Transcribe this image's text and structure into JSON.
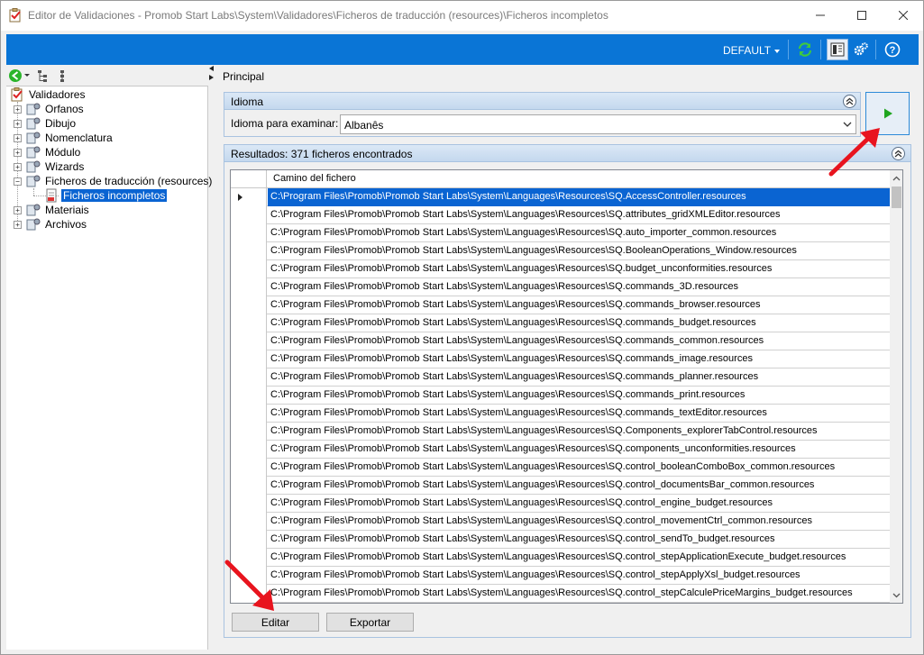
{
  "window": {
    "title": "Editor de Validaciones - Promob Start Labs\\System\\Validadores\\Ficheros de traducción (resources)\\Ficheros incompletos"
  },
  "toolbar": {
    "profile": "DEFAULT",
    "icons": [
      "refresh-icon",
      "layout-panel-icon",
      "settings-gears-icon",
      "help-icon"
    ]
  },
  "tree": {
    "root": "Validadores",
    "items": [
      {
        "label": "Orfanos",
        "expanded": false
      },
      {
        "label": "Dibujo",
        "expanded": false
      },
      {
        "label": "Nomenclatura",
        "expanded": false
      },
      {
        "label": "Módulo",
        "expanded": false
      },
      {
        "label": "Wizards",
        "expanded": false
      },
      {
        "label": "Ficheros de traducción (resources)",
        "expanded": true
      },
      {
        "label": "Materiais",
        "expanded": false
      },
      {
        "label": "Archivos",
        "expanded": false
      }
    ],
    "selected_child": "Ficheros incompletos"
  },
  "main": {
    "tab": "Principal",
    "idioma": {
      "title": "Idioma",
      "label": "Idioma para examinar:",
      "value": "Albanês"
    },
    "results": {
      "title": "Resultados: 371 ficheros encontrados",
      "column": "Camino del fichero",
      "rows": [
        "C:\\Program Files\\Promob\\Promob Start Labs\\System\\Languages\\Resources\\SQ.AccessController.resources",
        "C:\\Program Files\\Promob\\Promob Start Labs\\System\\Languages\\Resources\\SQ.attributes_gridXMLEditor.resources",
        "C:\\Program Files\\Promob\\Promob Start Labs\\System\\Languages\\Resources\\SQ.auto_importer_common.resources",
        "C:\\Program Files\\Promob\\Promob Start Labs\\System\\Languages\\Resources\\SQ.BooleanOperations_Window.resources",
        "C:\\Program Files\\Promob\\Promob Start Labs\\System\\Languages\\Resources\\SQ.budget_unconformities.resources",
        "C:\\Program Files\\Promob\\Promob Start Labs\\System\\Languages\\Resources\\SQ.commands_3D.resources",
        "C:\\Program Files\\Promob\\Promob Start Labs\\System\\Languages\\Resources\\SQ.commands_browser.resources",
        "C:\\Program Files\\Promob\\Promob Start Labs\\System\\Languages\\Resources\\SQ.commands_budget.resources",
        "C:\\Program Files\\Promob\\Promob Start Labs\\System\\Languages\\Resources\\SQ.commands_common.resources",
        "C:\\Program Files\\Promob\\Promob Start Labs\\System\\Languages\\Resources\\SQ.commands_image.resources",
        "C:\\Program Files\\Promob\\Promob Start Labs\\System\\Languages\\Resources\\SQ.commands_planner.resources",
        "C:\\Program Files\\Promob\\Promob Start Labs\\System\\Languages\\Resources\\SQ.commands_print.resources",
        "C:\\Program Files\\Promob\\Promob Start Labs\\System\\Languages\\Resources\\SQ.commands_textEditor.resources",
        "C:\\Program Files\\Promob\\Promob Start Labs\\System\\Languages\\Resources\\SQ.Components_explorerTabControl.resources",
        "C:\\Program Files\\Promob\\Promob Start Labs\\System\\Languages\\Resources\\SQ.components_unconformities.resources",
        "C:\\Program Files\\Promob\\Promob Start Labs\\System\\Languages\\Resources\\SQ.control_booleanComboBox_common.resources",
        "C:\\Program Files\\Promob\\Promob Start Labs\\System\\Languages\\Resources\\SQ.control_documentsBar_common.resources",
        "C:\\Program Files\\Promob\\Promob Start Labs\\System\\Languages\\Resources\\SQ.control_engine_budget.resources",
        "C:\\Program Files\\Promob\\Promob Start Labs\\System\\Languages\\Resources\\SQ.control_movementCtrl_common.resources",
        "C:\\Program Files\\Promob\\Promob Start Labs\\System\\Languages\\Resources\\SQ.control_sendTo_budget.resources",
        "C:\\Program Files\\Promob\\Promob Start Labs\\System\\Languages\\Resources\\SQ.control_stepApplicationExecute_budget.resources",
        "C:\\Program Files\\Promob\\Promob Start Labs\\System\\Languages\\Resources\\SQ.control_stepApplyXsl_budget.resources",
        "C:\\Program Files\\Promob\\Promob Start Labs\\System\\Languages\\Resources\\SQ.control_stepCalculePriceMargins_budget.resources"
      ]
    },
    "buttons": {
      "edit": "Editar",
      "export": "Exportar"
    }
  },
  "colors": {
    "accent": "#0a75d6",
    "selection": "#0a64d2",
    "annotation_arrow": "#e8141e",
    "run": "#1fa51f"
  }
}
